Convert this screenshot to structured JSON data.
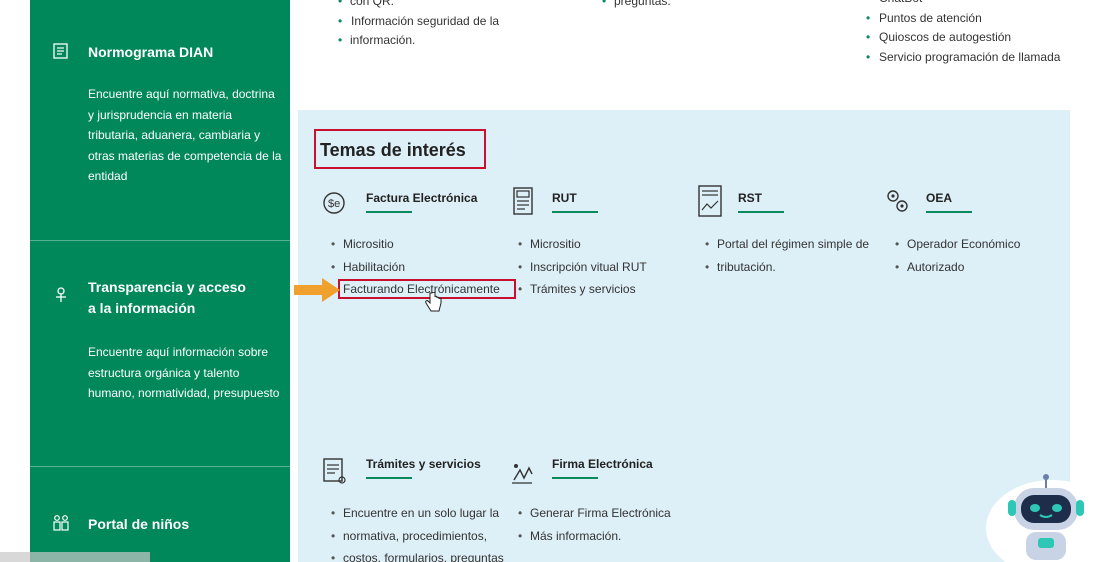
{
  "sidebar": {
    "normograma": {
      "title": "Normograma DIAN",
      "desc": "Encuentre aquí normativa, doctrina y jurisprudencia en materia tributaria, aduanera, cambiaria y otras materias de competencia de la entidad"
    },
    "transparencia": {
      "title_l1": "Transparencia y acceso",
      "title_l2": "a la información",
      "desc": "Encuentre aquí información sobre estructura orgánica y talento humano, normatividad, presupuesto"
    },
    "ninos": {
      "title": "Portal de niños"
    }
  },
  "top": {
    "left": [
      "con QR.",
      "Información seguridad de la",
      "información."
    ],
    "middle": [
      "preguntas."
    ],
    "right": [
      "ChatBot",
      "Puntos de atención",
      "Quioscos de autogestión",
      "Servicio programación de llamada"
    ]
  },
  "panel": {
    "title": "Temas de interés",
    "topics": [
      {
        "title": "Factura Electrónica",
        "items": [
          "Micrositio",
          "Habilitación",
          "Facturando Electrónicamente"
        ]
      },
      {
        "title": "RUT",
        "items": [
          "Micrositio",
          "Inscripción vitual RUT",
          "Trámites y servicios"
        ]
      },
      {
        "title": "RST",
        "items": [
          "Portal del régimen simple de",
          "tributación."
        ]
      },
      {
        "title": "OEA",
        "items": [
          "Operador Económico",
          "Autorizado"
        ]
      },
      {
        "title": "Trámites y servicios",
        "items": [
          "Encuentre en un solo lugar la",
          "normativa, procedimientos,",
          "costos, formularios, preguntas"
        ]
      },
      {
        "title": "Firma Electrónica",
        "items": [
          "Generar Firma Electrónica",
          "Más información."
        ]
      }
    ]
  },
  "colors": {
    "sidebar": "#00875a",
    "panel": "#ddeff7",
    "highlight": "#c8102e",
    "arrow": "#f0a02c",
    "accent": "#0a8a5a"
  }
}
